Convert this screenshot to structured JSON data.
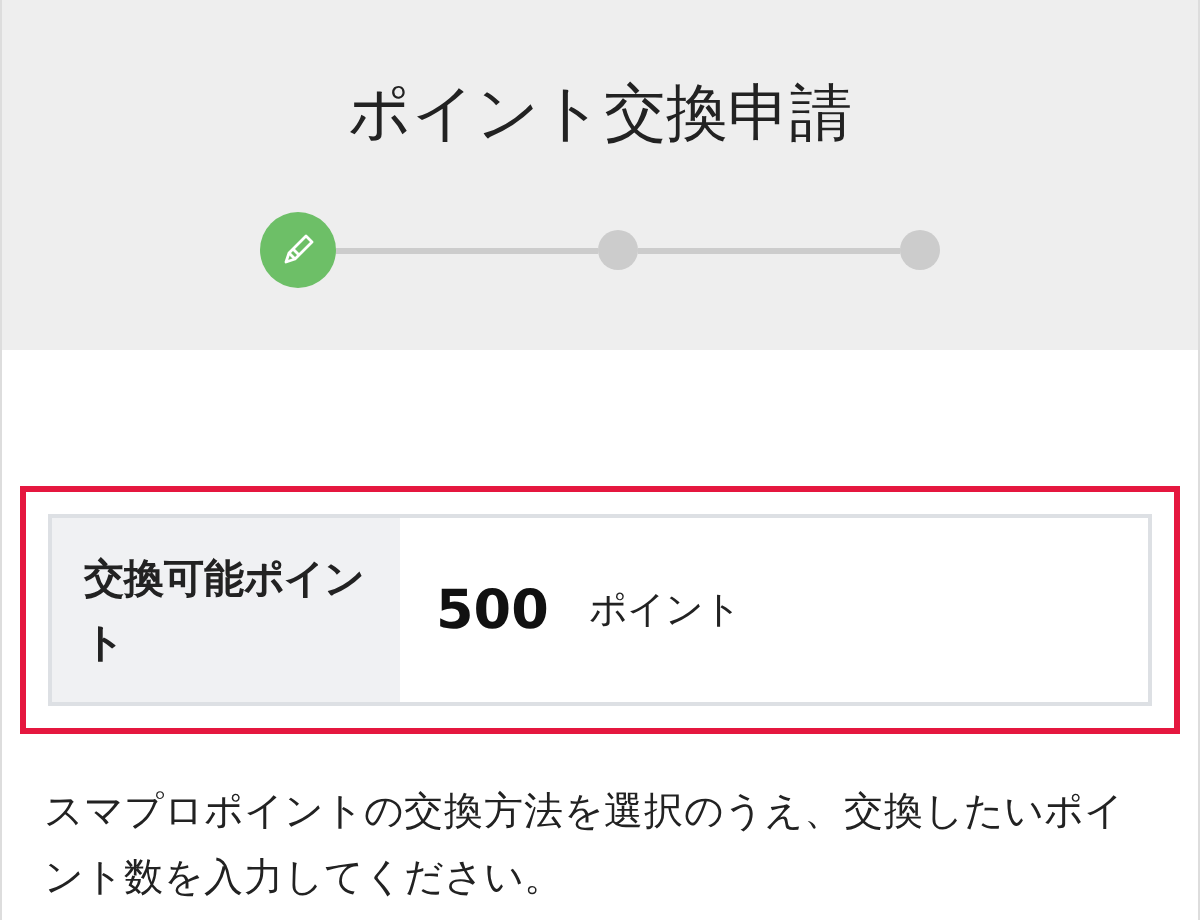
{
  "header": {
    "title": "ポイント交換申請"
  },
  "steps": [
    {
      "current": true
    },
    {
      "current": false
    },
    {
      "current": false
    }
  ],
  "points": {
    "label": "交換可能ポイント",
    "value": "500",
    "unit": "ポイント"
  },
  "instruction": "スマプロポイントの交換方法を選択のうえ、交換したいポイント数を入力してください。"
}
